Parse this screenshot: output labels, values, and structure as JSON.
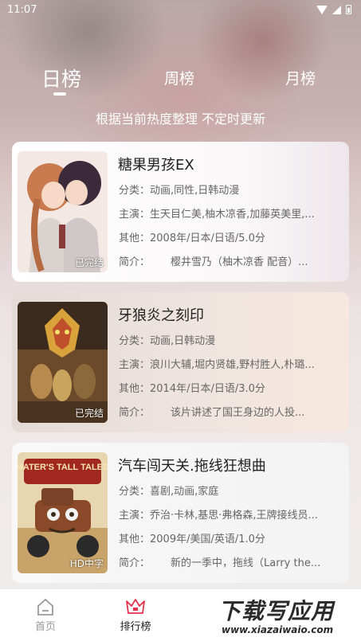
{
  "status": {
    "time": "11:07"
  },
  "tabs": {
    "daily": "日榜",
    "weekly": "周榜",
    "monthly": "月榜"
  },
  "subtitle": "根据当前热度整理 不定时更新",
  "labels": {
    "category": "分类：",
    "cast": "主演：",
    "other": "其他：",
    "intro": "简介："
  },
  "items": [
    {
      "title": "糖果男孩EX",
      "category": "动画,同性,日韩动漫",
      "cast": "生天目仁美,柚木凉香,加藤英美里,...",
      "other": "2008年/日本/日语/5.0分",
      "intro": "樱井雪乃（柚木凉香 配音）...",
      "badge": "已完结"
    },
    {
      "title": "牙狼炎之刻印",
      "category": "动画,日韩动漫",
      "cast": "浪川大辅,堀内贤雄,野村胜人,朴璐...",
      "other": "2014年/日本/日语/3.0分",
      "intro": "该片讲述了国王身边的人投...",
      "badge": "已完结"
    },
    {
      "title": "汽车闯天关.拖线狂想曲",
      "category": "喜剧,动画,家庭",
      "cast": "乔治·卡林,基思·弗格森,王牌接线员...",
      "other": "2009年/美国/英语/1.0分",
      "intro": "新的一季中，拖线（Larry the...",
      "badge": "HD中字",
      "poster_text": "MATER'S TALL TALES"
    }
  ],
  "nav": {
    "home": "首页",
    "rank": "排行榜"
  },
  "watermark": {
    "main": "下载写应用",
    "url": "www.xiazaiwaio.com"
  },
  "colors": {
    "accent": "#e0334c",
    "text_primary": "#222222",
    "text_secondary": "#666666"
  }
}
